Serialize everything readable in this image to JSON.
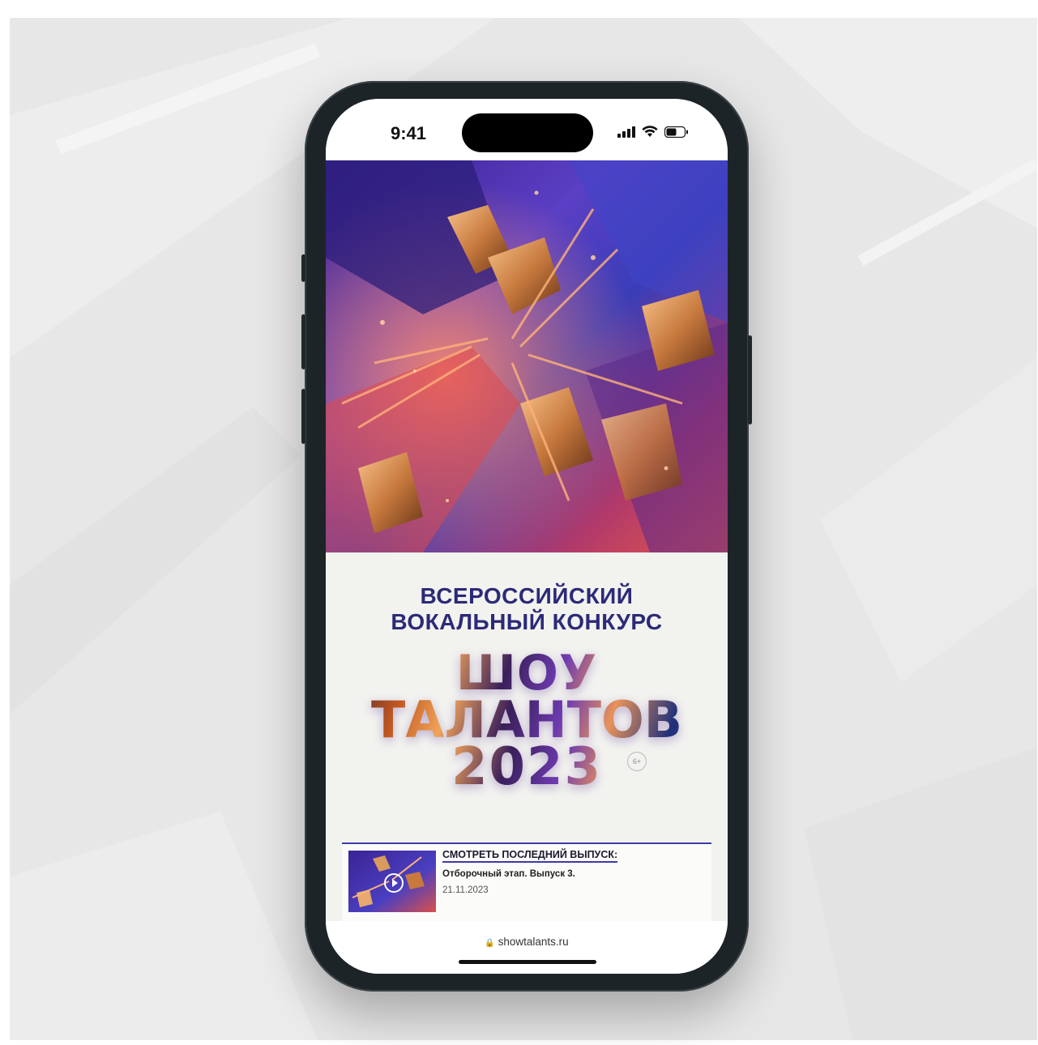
{
  "status_bar": {
    "time": "9:41",
    "icons": [
      "cellular-signal-icon",
      "wifi-icon",
      "battery-icon"
    ]
  },
  "hero": {
    "image": "abstract-explosion-artwork"
  },
  "contest": {
    "line1": "ВСЕРОССИЙСКИЙ",
    "line2": "ВОКАЛЬНЫЙ КОНКУРС"
  },
  "show": {
    "line1": "ШОУ",
    "line2": "ТАЛАНТОВ",
    "line3": "2023",
    "age_rating": "6+"
  },
  "latest_episode": {
    "heading": "СМОТРЕТЬ ПОСЛЕДНИЙ ВЫПУСК:",
    "title": "Отборочный этап. Выпуск 3.",
    "date": "21.11.2023"
  },
  "browser": {
    "url": "showtalants.ru"
  },
  "colors": {
    "title_blue": "#2c2a78",
    "accent_line": "#3c3aa7",
    "phone_frame": "#1d2428",
    "backdrop": "#e7e7e8"
  }
}
